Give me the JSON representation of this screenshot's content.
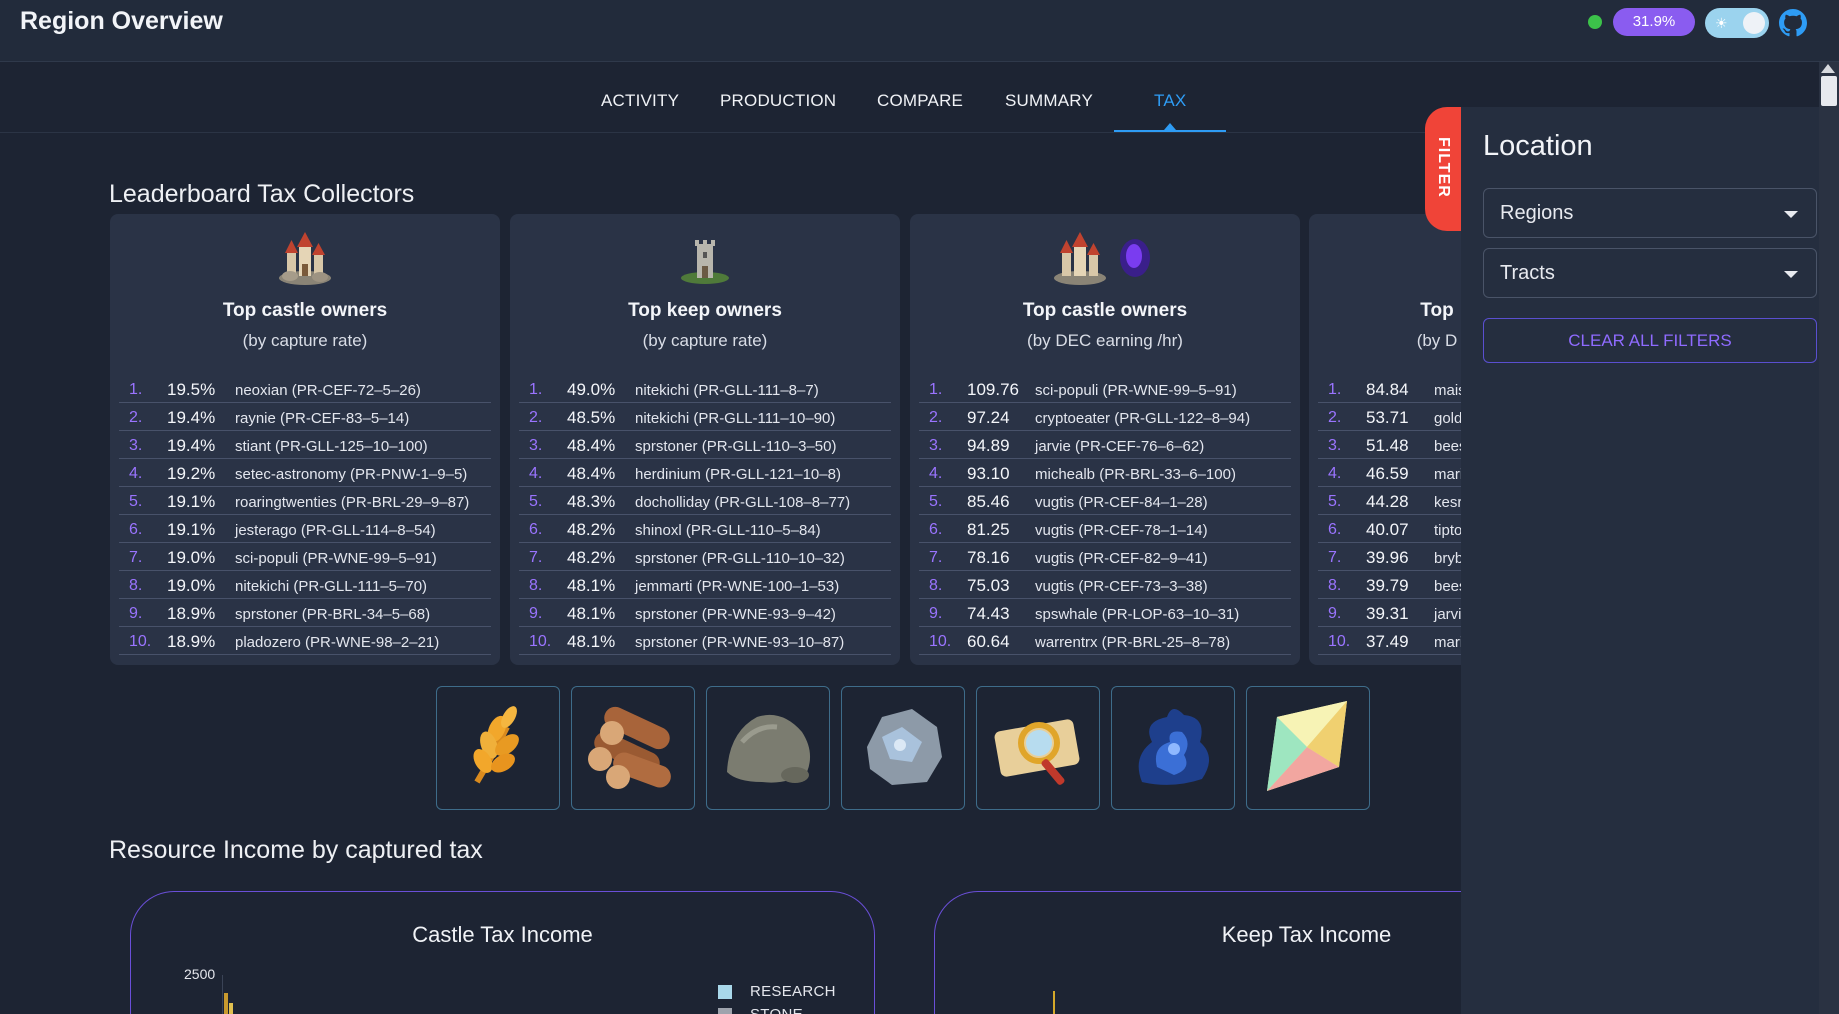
{
  "header": {
    "title": "Region Overview",
    "percent_badge": "31.9%"
  },
  "tabs": [
    {
      "label": "ACTIVITY"
    },
    {
      "label": "PRODUCTION"
    },
    {
      "label": "COMPARE"
    },
    {
      "label": "SUMMARY"
    },
    {
      "label": "TAX",
      "active": true
    }
  ],
  "leaderboard": {
    "title": "Leaderboard Tax Collectors",
    "cards": [
      {
        "title": "Top castle owners",
        "subtitle": "(by capture rate)",
        "rows": [
          {
            "rank": "1.",
            "value": "19.5%",
            "name": "neoxian (PR-CEF-72–5–26)"
          },
          {
            "rank": "2.",
            "value": "19.4%",
            "name": "raynie (PR-CEF-83–5–14)"
          },
          {
            "rank": "3.",
            "value": "19.4%",
            "name": "stiant (PR-GLL-125–10–100)"
          },
          {
            "rank": "4.",
            "value": "19.2%",
            "name": "setec-astronomy (PR-PNW-1–9–5)"
          },
          {
            "rank": "5.",
            "value": "19.1%",
            "name": "roaringtwenties (PR-BRL-29–9–87)"
          },
          {
            "rank": "6.",
            "value": "19.1%",
            "name": "jesterago (PR-GLL-114–8–54)"
          },
          {
            "rank": "7.",
            "value": "19.0%",
            "name": "sci-populi (PR-WNE-99–5–91)"
          },
          {
            "rank": "8.",
            "value": "19.0%",
            "name": "nitekichi (PR-GLL-111–5–70)"
          },
          {
            "rank": "9.",
            "value": "18.9%",
            "name": "sprstoner (PR-BRL-34–5–68)"
          },
          {
            "rank": "10.",
            "value": "18.9%",
            "name": "pladozero (PR-WNE-98–2–21)"
          }
        ]
      },
      {
        "title": "Top keep owners",
        "subtitle": "(by capture rate)",
        "rows": [
          {
            "rank": "1.",
            "value": "49.0%",
            "name": "nitekichi (PR-GLL-111–8–7)"
          },
          {
            "rank": "2.",
            "value": "48.5%",
            "name": "nitekichi (PR-GLL-111–10–90)"
          },
          {
            "rank": "3.",
            "value": "48.4%",
            "name": "sprstoner (PR-GLL-110–3–50)"
          },
          {
            "rank": "4.",
            "value": "48.4%",
            "name": "herdinium (PR-GLL-121–10–8)"
          },
          {
            "rank": "5.",
            "value": "48.3%",
            "name": "docholliday (PR-GLL-108–8–77)"
          },
          {
            "rank": "6.",
            "value": "48.2%",
            "name": "shinoxl (PR-GLL-110–5–84)"
          },
          {
            "rank": "7.",
            "value": "48.2%",
            "name": "sprstoner (PR-GLL-110–10–32)"
          },
          {
            "rank": "8.",
            "value": "48.1%",
            "name": "jemmarti (PR-WNE-100–1–53)"
          },
          {
            "rank": "9.",
            "value": "48.1%",
            "name": "sprstoner (PR-WNE-93–9–42)"
          },
          {
            "rank": "10.",
            "value": "48.1%",
            "name": "sprstoner (PR-WNE-93–10–87)"
          }
        ]
      },
      {
        "title": "Top castle owners",
        "subtitle": "(by DEC earning /hr)",
        "rows": [
          {
            "rank": "1.",
            "value": "109.76",
            "name": "sci-populi (PR-WNE-99–5–91)"
          },
          {
            "rank": "2.",
            "value": "97.24",
            "name": "cryptoeater (PR-GLL-122–8–94)"
          },
          {
            "rank": "3.",
            "value": "94.89",
            "name": "jarvie (PR-CEF-76–6–62)"
          },
          {
            "rank": "4.",
            "value": "93.10",
            "name": "michealb (PR-BRL-33–6–100)"
          },
          {
            "rank": "5.",
            "value": "85.46",
            "name": "vugtis (PR-CEF-84–1–28)"
          },
          {
            "rank": "6.",
            "value": "81.25",
            "name": "vugtis (PR-CEF-78–1–14)"
          },
          {
            "rank": "7.",
            "value": "78.16",
            "name": "vugtis (PR-CEF-82–9–41)"
          },
          {
            "rank": "8.",
            "value": "75.03",
            "name": "vugtis (PR-CEF-73–3–38)"
          },
          {
            "rank": "9.",
            "value": "74.43",
            "name": "spswhale (PR-LOP-63–10–31)"
          },
          {
            "rank": "10.",
            "value": "60.64",
            "name": "warrentrx (PR-BRL-25–8–78)"
          }
        ]
      },
      {
        "title": "Top",
        "subtitle": "(by D",
        "rows": [
          {
            "rank": "1.",
            "value": "84.84",
            "name": "mais"
          },
          {
            "rank": "2.",
            "value": "53.71",
            "name": "gold"
          },
          {
            "rank": "3.",
            "value": "51.48",
            "name": "bees"
          },
          {
            "rank": "4.",
            "value": "46.59",
            "name": "mari"
          },
          {
            "rank": "5.",
            "value": "44.28",
            "name": "kesr"
          },
          {
            "rank": "6.",
            "value": "40.07",
            "name": "tipto"
          },
          {
            "rank": "7.",
            "value": "39.96",
            "name": "bryb"
          },
          {
            "rank": "8.",
            "value": "39.79",
            "name": "bees"
          },
          {
            "rank": "9.",
            "value": "39.31",
            "name": "jarvi"
          },
          {
            "rank": "10.",
            "value": "37.49",
            "name": "mari"
          }
        ]
      }
    ]
  },
  "resources": [
    {
      "icon": "grain-icon"
    },
    {
      "icon": "wood-icon"
    },
    {
      "icon": "stone-icon"
    },
    {
      "icon": "iron-icon"
    },
    {
      "icon": "research-icon"
    },
    {
      "icon": "aura-icon"
    },
    {
      "icon": "sps-crystal-icon"
    }
  ],
  "income": {
    "title": "Resource Income by captured tax",
    "castle_chart": {
      "title": "Castle Tax Income",
      "ytick": "2500",
      "legend": [
        {
          "label": "RESEARCH",
          "color": "#a9d8ea"
        },
        {
          "label": "STONE",
          "color": "#9ea3ad"
        }
      ]
    },
    "keep_chart": {
      "title": "Keep Tax Income"
    }
  },
  "filter": {
    "tab_label": "FILTER",
    "title": "Location",
    "regions_label": "Regions",
    "tracts_label": "Tracts",
    "clear_label": "CLEAR ALL FILTERS"
  },
  "colors": {
    "accent": "#8a5cf0",
    "tab_active": "#2e9cf5",
    "filter_tab": "#f04438",
    "rank": "#9a74ff"
  }
}
